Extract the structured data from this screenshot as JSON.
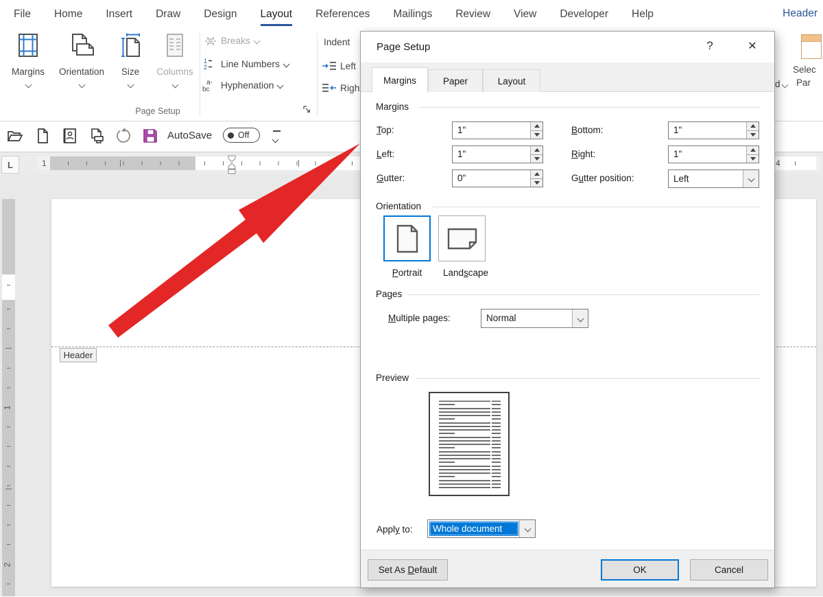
{
  "colors": {
    "accent": "#2b579a",
    "selection": "#0078d7",
    "arrow-red": "#e32726",
    "save-purple": "#b14db0",
    "disabled": "#a6a6a6"
  },
  "menu": {
    "tabs": [
      "File",
      "Home",
      "Insert",
      "Draw",
      "Design",
      "Layout",
      "References",
      "Mailings",
      "Review",
      "View",
      "Developer",
      "Help"
    ],
    "active_tab": "Layout",
    "right_label": "Header"
  },
  "ribbon": {
    "group_label": "Page Setup",
    "buttons": {
      "margins": "Margins",
      "orientation": "Orientation",
      "size": "Size",
      "columns": "Columns",
      "breaks": "Breaks",
      "line_numbers": "Line Numbers",
      "hyphenation": "Hyphenation"
    },
    "indent": {
      "title": "Indent",
      "left": "Left",
      "right": "Right"
    },
    "fragment": {
      "line1": "Selec",
      "line2": "Par",
      "stub": "d"
    }
  },
  "quick_access": {
    "autosave_label": "AutoSave",
    "autosave_state": "Off"
  },
  "ruler": {
    "tab_selector": "L",
    "h_numbers": [
      "1",
      "1",
      "4"
    ],
    "v_numbers": [
      "1",
      "2"
    ]
  },
  "document": {
    "header_tag": "Header"
  },
  "dialog": {
    "title": "Page Setup",
    "help_glyph": "?",
    "close_glyph": "✕",
    "tabs": [
      "Margins",
      "Paper",
      "Layout"
    ],
    "active_tab": "Margins",
    "sections": {
      "margins": "Margins",
      "orientation": "Orientation",
      "pages": "Pages",
      "preview": "Preview"
    },
    "margins": {
      "top": {
        "pre": "",
        "key": "T",
        "post": "op:",
        "value": "1\""
      },
      "bottom": {
        "pre": "",
        "key": "B",
        "post": "ottom:",
        "value": "1\""
      },
      "left": {
        "pre": "",
        "key": "L",
        "post": "eft:",
        "value": "1\""
      },
      "right": {
        "pre": "",
        "key": "R",
        "post": "ight:",
        "value": "1\""
      },
      "gutter": {
        "pre": "",
        "key": "G",
        "post": "utter:",
        "value": "0\""
      },
      "gutter_position": {
        "pre": "G",
        "key": "u",
        "post": "tter position:",
        "value": "Left"
      }
    },
    "orientation": {
      "portrait": {
        "pre": "",
        "key": "P",
        "post": "ortrait"
      },
      "landscape": {
        "pre": "Land",
        "key": "s",
        "post": "cape"
      },
      "selected": "Portrait"
    },
    "pages": {
      "multiple_pages": {
        "pre": "",
        "key": "M",
        "post": "ultiple pages:",
        "value": "Normal"
      }
    },
    "apply_to": {
      "pre": "Appl",
      "key": "y",
      "post": " to:",
      "value": "Whole document"
    },
    "buttons": {
      "set_default": {
        "pre": "Set As ",
        "key": "D",
        "post": "efault"
      },
      "ok": "OK",
      "cancel": "Cancel"
    }
  }
}
